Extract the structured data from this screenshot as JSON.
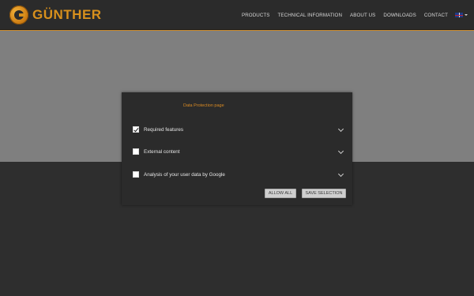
{
  "brand": {
    "name": "GÜNTHER",
    "logo_icon": "guenther-g-logo"
  },
  "nav": {
    "items": [
      {
        "label": "PRODUCTS"
      },
      {
        "label": "TECHNICAL INFORMATION"
      },
      {
        "label": "ABOUT US"
      },
      {
        "label": "DOWNLOADS"
      },
      {
        "label": "CONTACT"
      }
    ],
    "language": {
      "icon": "uk-flag-icon"
    }
  },
  "colors": {
    "accent": "#d8901c",
    "header_bg": "#2b2b2b",
    "hero_bg": "#7f7f7f",
    "page_bg": "#2e2e2e",
    "modal_bg": "#2b2b2b"
  },
  "consent": {
    "link": "Data Protection page",
    "options": [
      {
        "label": "Required features",
        "checked": true
      },
      {
        "label": "External content",
        "checked": false
      },
      {
        "label": "Analysis of your user data by Google",
        "checked": false
      }
    ],
    "allow_all_label": "ALLOW ALL",
    "save_selection_label": "SAVE SELECTION"
  }
}
